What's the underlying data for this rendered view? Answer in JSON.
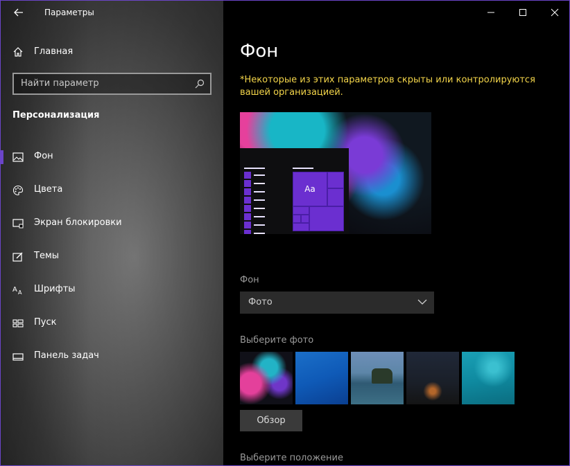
{
  "window": {
    "title": "Параметры",
    "accent": "#6b45c9"
  },
  "sidebar": {
    "home_label": "Главная",
    "search": {
      "placeholder": "Найти параметр"
    },
    "section_title": "Персонализация",
    "items": [
      {
        "label": "Фон",
        "icon": "image-icon",
        "active": true
      },
      {
        "label": "Цвета",
        "icon": "palette-icon",
        "active": false
      },
      {
        "label": "Экран блокировки",
        "icon": "lock-screen-icon",
        "active": false
      },
      {
        "label": "Темы",
        "icon": "themes-icon",
        "active": false
      },
      {
        "label": "Шрифты",
        "icon": "fonts-icon",
        "active": false
      },
      {
        "label": "Пуск",
        "icon": "start-icon",
        "active": false
      },
      {
        "label": "Панель задач",
        "icon": "taskbar-icon",
        "active": false
      }
    ]
  },
  "main": {
    "title": "Фон",
    "notice": "*Некоторые из этих параметров скрыты или контролируются вашей организацией.",
    "notice_color": "#f3d54a",
    "preview": {
      "tile_text": "Aa"
    },
    "background_label": "Фон",
    "background_select": {
      "value": "Фото"
    },
    "choose_photo_label": "Выберите фото",
    "photos": [
      "photo-thumb-1",
      "photo-thumb-2",
      "photo-thumb-3",
      "photo-thumb-4",
      "photo-thumb-5"
    ],
    "browse_button": "Обзор",
    "choose_fit_label": "Выберите положение"
  }
}
